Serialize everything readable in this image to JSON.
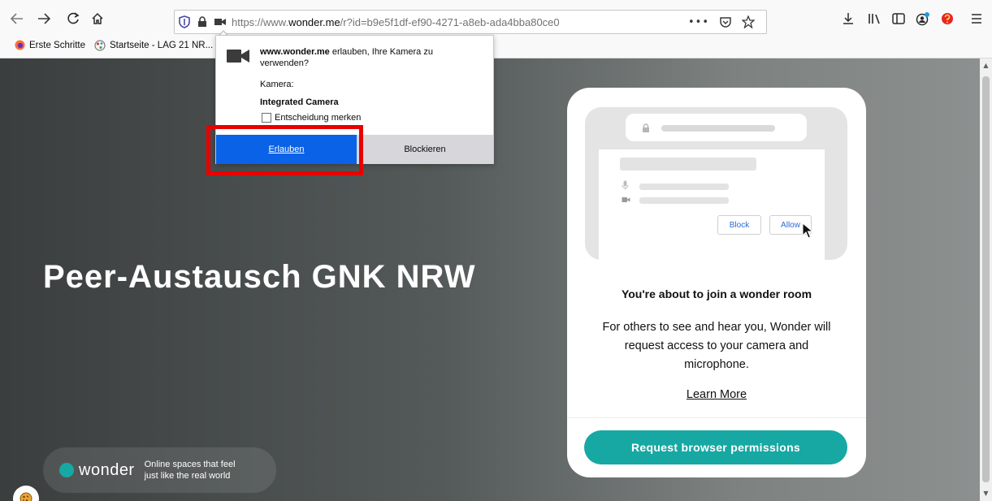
{
  "browser": {
    "url_prefix": "https://www.",
    "url_host": "wonder.me",
    "url_path": "/r?id=b9e5f1df-ef90-4271-a8eb-ada4bba80ce0",
    "nav_icons": [
      "back-icon",
      "forward-icon",
      "reload-icon",
      "home-icon"
    ],
    "urlbar_icons": [
      "tracking-shield-icon",
      "lock-icon",
      "camera-icon"
    ],
    "page_action_icons": [
      "more-icon",
      "pocket-icon",
      "bookmark-star-icon"
    ],
    "toolbar_icons": [
      "download-icon",
      "library-icon",
      "sidebar-icon",
      "account-icon",
      "extension-icon",
      "menu-icon"
    ]
  },
  "bookmarks": [
    {
      "label": "Erste Schritte",
      "icon": "firefox-icon"
    },
    {
      "label": "Startseite - LAG 21 NR...",
      "icon": "globe-icon"
    }
  ],
  "permission_popup": {
    "site": "www.wonder.me",
    "message": " erlauben, Ihre Kamera zu verwenden?",
    "camera_label": "Kamera:",
    "camera_device": "Integrated Camera",
    "remember_label": "Entscheidung merken",
    "allow_label": "Erlauben",
    "block_label": "Blockieren"
  },
  "page": {
    "room_title": "Peer-Austausch GNK NRW",
    "brand_name": "wonder",
    "brand_tagline": "Online spaces that feel just like the real world"
  },
  "card": {
    "illustration": {
      "block_label": "Block",
      "allow_label": "Allow"
    },
    "heading": "You're about to join a wonder room",
    "body": "For others to see and hear you, Wonder will request access to your camera and microphone.",
    "learn_more": "Learn More",
    "cta": "Request browser permissions"
  },
  "colors": {
    "accent_teal": "#17a8a3",
    "allow_blue": "#0a62e6",
    "highlight_red": "#e80000"
  }
}
